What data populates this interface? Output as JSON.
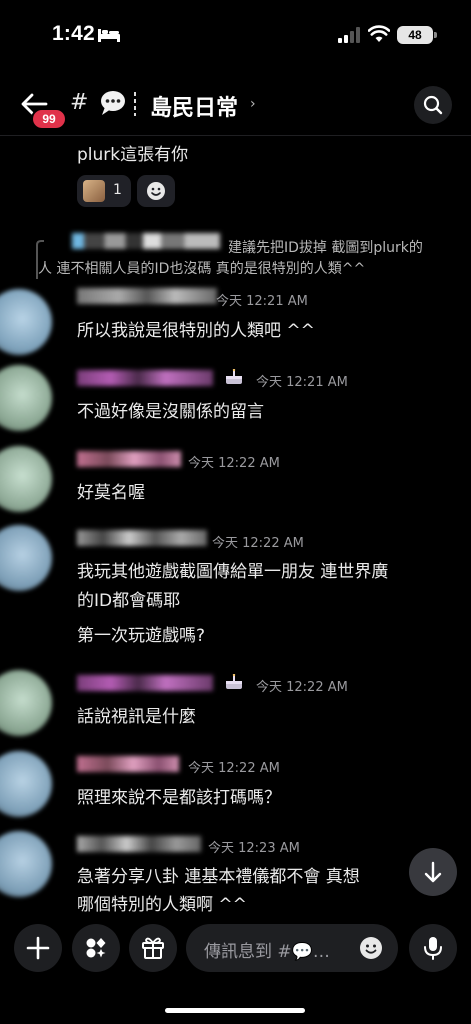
{
  "status_bar": {
    "time": "1:42",
    "battery": "48"
  },
  "header": {
    "badge": "99",
    "hash": "#",
    "channel_name": "島民日常",
    "chevron": "›"
  },
  "messages": [
    {
      "text": "plurk這張有你",
      "reaction_count": "1"
    },
    {
      "reply_line1": "建議先把ID拔掉 截圖到plurk的",
      "reply_line2": "人 連不相關人員的ID也沒碼 真的是很特別的人類^^",
      "time": "今天 12:21 AM",
      "text": "所以我說是很特別的人類吧 ^^"
    },
    {
      "time": "今天 12:21 AM",
      "text": "不過好像是沒關係的留言"
    },
    {
      "time": "今天 12:22 AM",
      "text": "好莫名喔"
    },
    {
      "time": "今天 12:22 AM",
      "line1": "我玩其他遊戲截圖傳給單一朋友 連世界廣",
      "line2": "的ID都會碼耶",
      "line3": "第一次玩遊戲嗎?"
    },
    {
      "time": "今天 12:22 AM",
      "text": "話說視訊是什麼"
    },
    {
      "time": "今天 12:22 AM",
      "text": "照理來說不是都該打碼嗎？"
    },
    {
      "time": "今天 12:23 AM",
      "line1": "急著分享八卦 連基本禮儀都不會 真想",
      "line2": "哪個特別的人類啊 ^^"
    }
  ],
  "composer": {
    "placeholder": "傳訊息到 #💬…"
  },
  "icons": [
    "back-arrow-icon",
    "speech-bubble-icon",
    "search-icon",
    "cake-icon",
    "add-reaction-icon",
    "arrow-down-icon",
    "plus-icon",
    "apps-icon",
    "gift-icon",
    "emoji-icon",
    "microphone-icon"
  ],
  "colors": {
    "background": "#000000",
    "badge": "#e0324a",
    "surface": "#1e1f22",
    "timestamp": "#9a9a9e"
  }
}
